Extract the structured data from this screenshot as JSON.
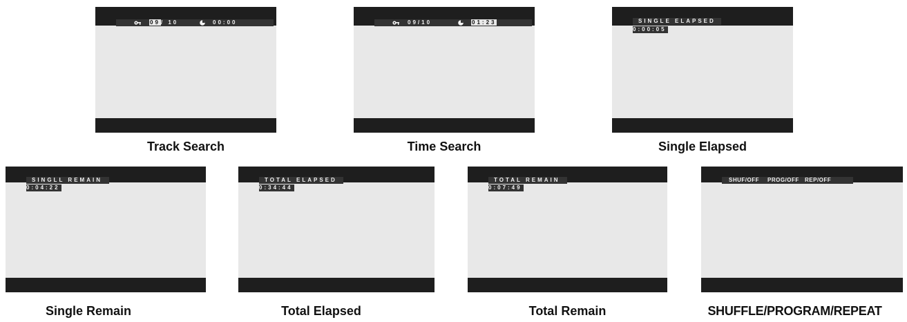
{
  "panels": {
    "track_search": {
      "caption": "Track Search",
      "track_current": "09",
      "track_sep_total": "/ 10",
      "time": "00:00"
    },
    "time_search": {
      "caption": "Time Search",
      "track": "09/10",
      "time": "01:23"
    },
    "single_elapsed": {
      "caption": "Single Elapsed",
      "label": "SINGLE ELAPSED",
      "time": "0:00:05"
    },
    "single_remain": {
      "caption": "Single Remain",
      "label": "SINGLL REMAIN",
      "time": "0:04:22"
    },
    "total_elapsed": {
      "caption": "Total Elapsed",
      "label": "TOTAL ELAPSED",
      "time": "0:34:44"
    },
    "total_remain": {
      "caption": "Total Remain",
      "label": "TOTAL REMAIN",
      "time": "0:07:49"
    },
    "shuffle_program_repeat": {
      "caption": "SHUFFLE/PROGRAM/REPEAT",
      "shuffle": "SHUF/OFF",
      "program": "PROG/OFF",
      "repeat": "REP/OFF"
    }
  },
  "icons": {
    "track": "key-icon",
    "time": "clock-pie-icon"
  }
}
